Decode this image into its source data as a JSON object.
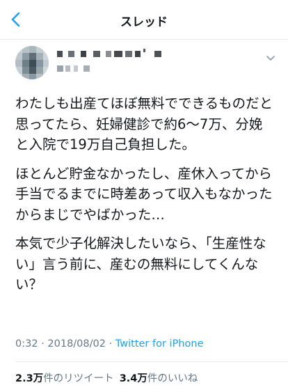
{
  "nav": {
    "title": "スレッド",
    "back_icon": "chevron-left-icon"
  },
  "tweet": {
    "paragraphs": [
      "わたしも出産てほぼ無料でできるものだと思ってたら、妊婦健診で約6〜7万、分娩と入院で19万自己負担した。",
      "ほとんど貯金なかったし、産休入ってから手当でるまでに時差あって収入もなかったからまじでやばかった…",
      "本気で少子化解決したいなら、「生産性ない」言う前に、産むの無料にしてくんない？"
    ],
    "time": "0:32",
    "date": "2018/08/02",
    "separator": "·",
    "source": "Twitter for iPhone"
  },
  "stats": {
    "retweet_count": "2.3万",
    "retweet_label": "件のリツイート",
    "like_count": "3.4万",
    "like_label": "件のいいね"
  },
  "colors": {
    "accent": "#1da1f2",
    "secondary_text": "#657786",
    "primary_text": "#14171a",
    "divider": "#e6ecf0"
  }
}
